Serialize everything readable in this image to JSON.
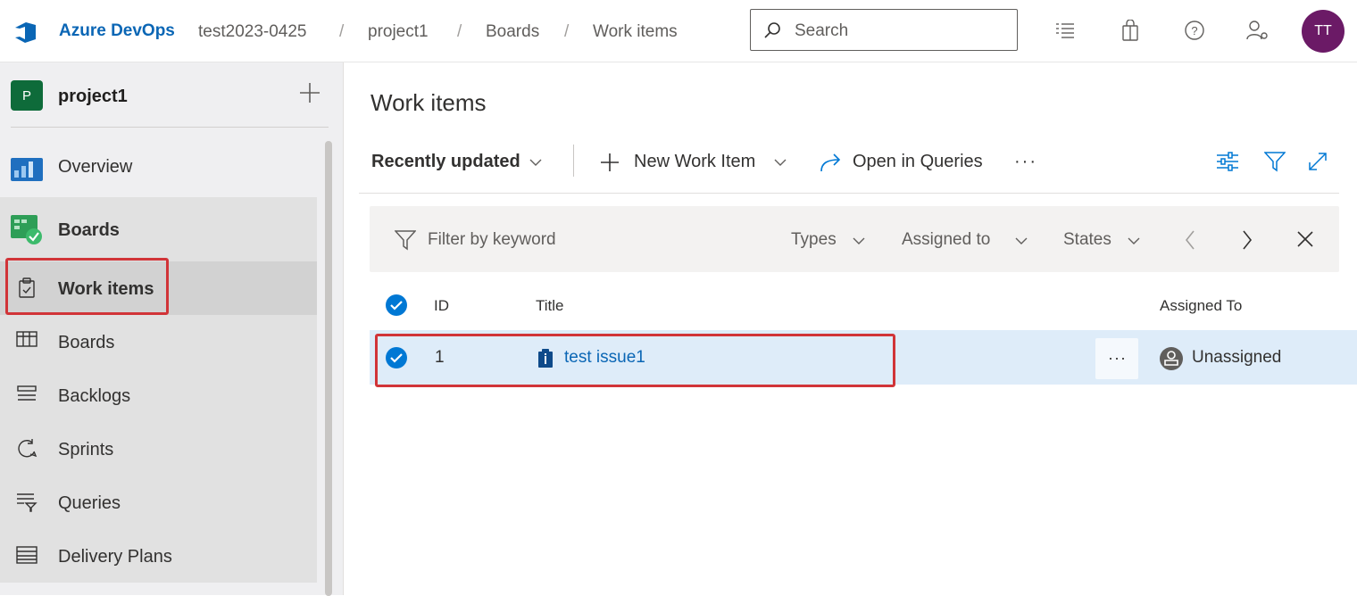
{
  "header": {
    "brand": "Azure DevOps",
    "breadcrumb": [
      "test2023-0425",
      "project1",
      "Boards",
      "Work items"
    ],
    "separator": "/",
    "search_placeholder": "Search",
    "avatar_initials": "TT",
    "icons": [
      "azure-devops-logo",
      "task-list-icon",
      "shopping-bag-icon",
      "help-icon",
      "user-settings-icon"
    ]
  },
  "sidebar": {
    "project_badge": "P",
    "project_name": "project1",
    "items": [
      {
        "label": "Overview",
        "icon": "overview-icon"
      },
      {
        "label": "Boards",
        "icon": "boards-icon"
      },
      {
        "label": "Work items",
        "icon": "work-items-icon"
      },
      {
        "label": "Boards",
        "icon": "board-columns-icon"
      },
      {
        "label": "Backlogs",
        "icon": "backlog-icon"
      },
      {
        "label": "Sprints",
        "icon": "sprint-icon"
      },
      {
        "label": "Queries",
        "icon": "query-icon"
      },
      {
        "label": "Delivery Plans",
        "icon": "delivery-plans-icon"
      }
    ]
  },
  "main": {
    "title": "Work items",
    "toolbar": {
      "view_label": "Recently updated",
      "new_item_label": "New Work Item",
      "open_queries_label": "Open in Queries",
      "more_label": "···"
    },
    "filter": {
      "placeholder": "Filter by keyword",
      "types": "Types",
      "assigned_to": "Assigned to",
      "states": "States"
    },
    "table": {
      "columns": [
        "ID",
        "Title",
        "Assigned To"
      ],
      "rows": [
        {
          "id": "1",
          "title": "test issue1",
          "assigned_to": "Unassigned",
          "more": "···"
        }
      ]
    }
  },
  "colors": {
    "brand": "#0a66b5",
    "accent": "#0078d4",
    "highlight": "#d13438",
    "selected_row": "#deecf9",
    "avatar": "#6b1a66",
    "project_badge": "#0e6b3a"
  }
}
